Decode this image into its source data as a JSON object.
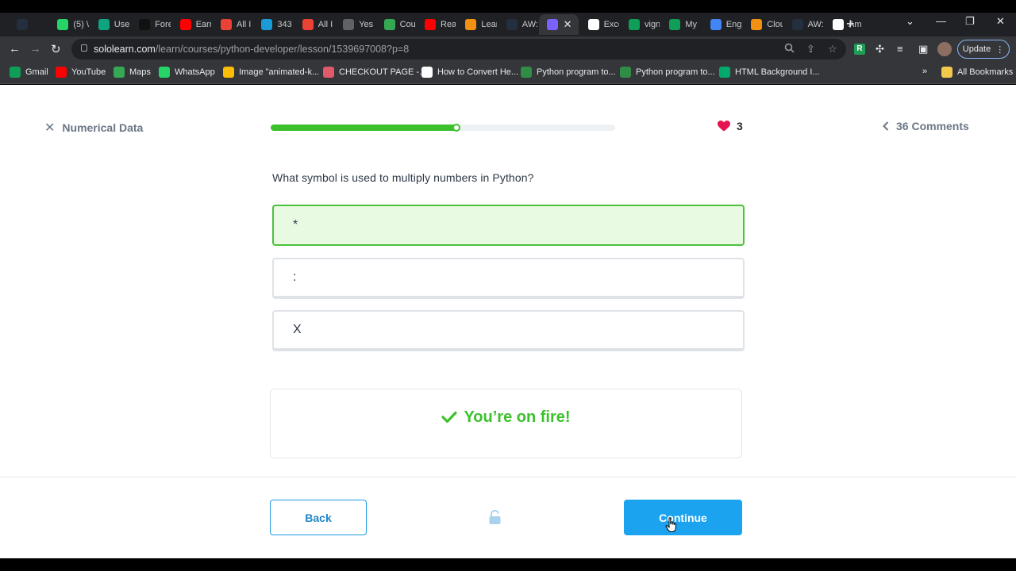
{
  "browser": {
    "tabs": [
      {
        "label": "",
        "icon": "aws-icon",
        "color": "#232f3e"
      },
      {
        "label": "(5) \\",
        "icon": "whatsapp-icon",
        "color": "#25d366"
      },
      {
        "label": "Use",
        "icon": "chatgpt-icon",
        "color": "#10a37f"
      },
      {
        "label": "Fore",
        "icon": "page-icon",
        "color": "#111111"
      },
      {
        "label": "Earr",
        "icon": "youtube-icon",
        "color": "#ff0000"
      },
      {
        "label": "All I",
        "icon": "gmail-icon",
        "color": "#ea4335"
      },
      {
        "label": "343",
        "icon": "is-icon",
        "color": "#1a9ad6"
      },
      {
        "label": "All I",
        "icon": "gmail-icon",
        "color": "#ea4335"
      },
      {
        "label": "Yes",
        "icon": "globe-icon",
        "color": "#5f6368"
      },
      {
        "label": "Cou",
        "icon": "play-icon",
        "color": "#34a853"
      },
      {
        "label": "Rea",
        "icon": "youtube-icon",
        "color": "#ff0000"
      },
      {
        "label": "Lear",
        "icon": "cube-icon",
        "color": "#f29111"
      },
      {
        "label": "AW:",
        "icon": "aws-icon",
        "color": "#232f3e"
      },
      {
        "label": "",
        "icon": "sololearn-icon",
        "color": "#7b61ff"
      },
      {
        "label": "Exce",
        "icon": "page-icon",
        "color": "#ffffff"
      },
      {
        "label": "vign",
        "icon": "sheets-icon",
        "color": "#0f9d58"
      },
      {
        "label": "My",
        "icon": "sheets-icon",
        "color": "#0f9d58"
      },
      {
        "label": "Eng",
        "icon": "d-icon",
        "color": "#4285f4"
      },
      {
        "label": "Clou",
        "icon": "cube-icon",
        "color": "#f29111"
      },
      {
        "label": "AW:",
        "icon": "aws-icon",
        "color": "#232f3e"
      },
      {
        "label": "Am",
        "icon": "amazon-icon",
        "color": "#ffffff"
      }
    ],
    "url_domain": "sololearn.com",
    "url_path": "/learn/courses/python-developer/lesson/1539697008?p=8",
    "update_label": "Update",
    "bookmarks": [
      {
        "label": "Gmail",
        "icon": "gmail-icon",
        "color": "#0f9d58"
      },
      {
        "label": "YouTube",
        "icon": "youtube-icon",
        "color": "#ff0000"
      },
      {
        "label": "Maps",
        "icon": "maps-icon",
        "color": "#34a853"
      },
      {
        "label": "WhatsApp",
        "icon": "whatsapp-icon",
        "color": "#25d366"
      },
      {
        "label": "Image \"animated-k...",
        "icon": "star-icon",
        "color": "#fbbc04"
      },
      {
        "label": "CHECKOUT PAGE -...",
        "icon": "lips-icon",
        "color": "#e05a6a"
      },
      {
        "label": "How to Convert He...",
        "icon": "alpha-icon",
        "color": "#ffffff"
      },
      {
        "label": "Python program to...",
        "icon": "gfg-icon",
        "color": "#2f8d46"
      },
      {
        "label": "Python program to...",
        "icon": "gfg-icon",
        "color": "#2f8d46"
      },
      {
        "label": "HTML Background I...",
        "icon": "w-icon",
        "color": "#04aa6d"
      }
    ],
    "all_bookmarks_label": "All Bookmarks"
  },
  "lesson": {
    "title": "Numerical Data",
    "progress": 0.54,
    "hearts": "3",
    "comments_label": "36 Comments",
    "question": "What symbol is used to multiply numbers in Python?",
    "options": [
      {
        "text": "*",
        "state": "correct"
      },
      {
        "text": ":",
        "state": "default"
      },
      {
        "text": "X",
        "state": "default"
      }
    ],
    "feedback": "You’re on fire!",
    "back_label": "Back",
    "continue_label": "Continue"
  },
  "colors": {
    "accent_green": "#3cc12c",
    "accent_blue": "#1ba3ef",
    "heart": "#e3144f"
  }
}
